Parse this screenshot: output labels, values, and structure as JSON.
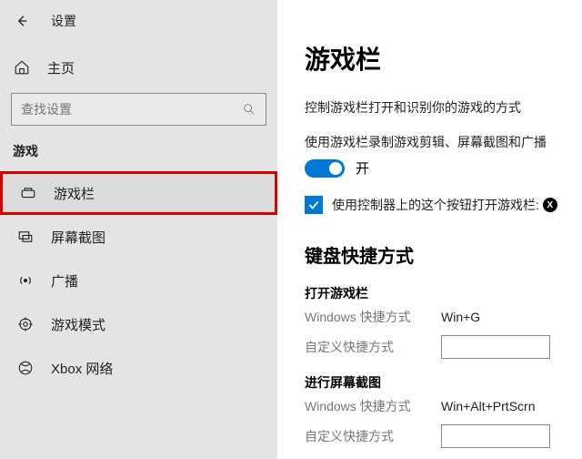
{
  "titlebar": {
    "title": "设置"
  },
  "home": {
    "label": "主页"
  },
  "search": {
    "placeholder": "查找设置"
  },
  "category": "游戏",
  "nav": [
    {
      "label": "游戏栏"
    },
    {
      "label": "屏幕截图"
    },
    {
      "label": "广播"
    },
    {
      "label": "游戏模式"
    },
    {
      "label": "Xbox 网络"
    }
  ],
  "page": {
    "heading": "游戏栏",
    "desc": "控制游戏栏打开和识别你的游戏的方式",
    "toggle_desc": "使用游戏栏录制游戏剪辑、屏幕截图和广播",
    "toggle_state": "开",
    "checkbox_label": "使用控制器上的这个按钮打开游戏栏:",
    "section2": "键盘快捷方式",
    "group1_label": "打开游戏栏",
    "group2_label": "进行屏幕截图",
    "win_shortcut_label": "Windows 快捷方式",
    "custom_shortcut_label": "自定义快捷方式",
    "shortcut_open": "Win+G",
    "shortcut_screenshot": "Win+Alt+PrtScrn"
  }
}
